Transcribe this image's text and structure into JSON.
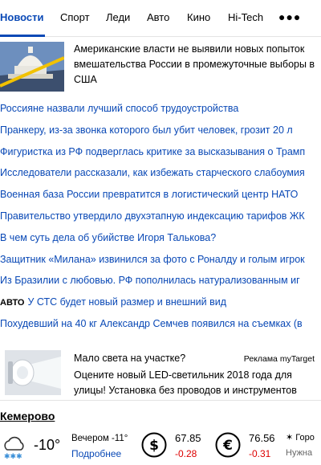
{
  "tabs": [
    "Новости",
    "Спорт",
    "Леди",
    "Авто",
    "Кино",
    "Hi-Tech"
  ],
  "more_icon": "three-dots-icon",
  "accent_color": "#0a49b6",
  "hero": {
    "text": "Американские власти не выявили новых попыток вмешательства России в промежуточные выборы в США"
  },
  "news": [
    {
      "prefix": "",
      "title": "Россияне назвали лучший способ трудоустройства"
    },
    {
      "prefix": "",
      "title": "Пранкеру, из-за звонка которого был убит человек, грозит 20 л"
    },
    {
      "prefix": "",
      "title": "Фигуристка из РФ подверглась критике за высказывания о Трамп"
    },
    {
      "prefix": "",
      "title": "Исследователи рассказали, как избежать старческого слабоумия"
    },
    {
      "prefix": "",
      "title": "Военная база России превратится в логистический центр НАТО"
    },
    {
      "prefix": "",
      "title": "Правительство утвердило двухэтапную индексацию тарифов ЖК"
    },
    {
      "prefix": "",
      "title": "В чем суть дела об убийстве Игоря Талькова?"
    },
    {
      "prefix": "",
      "title": "Защитник «Милана» извинился за фото с Роналду и голым игрок"
    },
    {
      "prefix": "",
      "title": "Из Бразилии с любовью. РФ пополнилась натурализованным иг"
    },
    {
      "prefix": "АВТО",
      "title": "У СТС будет новый размер и внешний вид"
    },
    {
      "prefix": "",
      "title": "Похудевший на 40 кг Александр Семчев появился на съемках (в"
    }
  ],
  "ad": {
    "title": "Мало света на участке?",
    "tag": "Реклама myTarget",
    "text": "Оцените новый LED-светильник 2018 года для улицы! Установка без проводов и инструментов"
  },
  "city": "Кемерово",
  "weather": {
    "temp": "-10°",
    "evening": "Вечером -11°",
    "details": "Подробнее"
  },
  "currency": [
    {
      "icon": "dollar-icon",
      "value": "67.85",
      "delta": "-0.28"
    },
    {
      "icon": "euro-icon",
      "value": "76.56",
      "delta": "-0.31"
    }
  ],
  "extra": {
    "line1": "✶ Горо",
    "line2": "Нужна"
  }
}
